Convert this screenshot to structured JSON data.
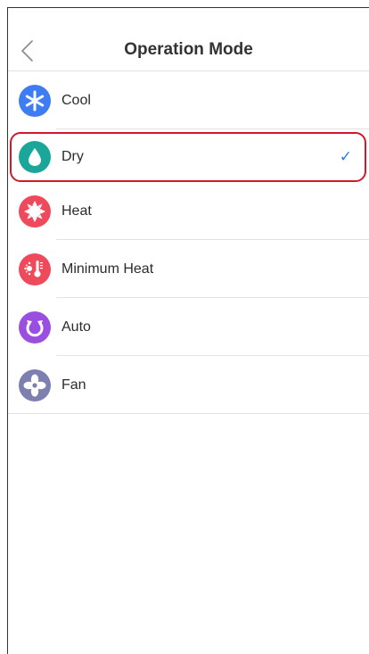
{
  "header": {
    "title": "Operation Mode"
  },
  "modes": [
    {
      "label": "Cool",
      "icon": "snowflake-icon",
      "color": "#3d7cf2"
    },
    {
      "label": "Dry",
      "icon": "water-drop-icon",
      "color": "#1aa79a",
      "selected": true
    },
    {
      "label": "Heat",
      "icon": "sun-icon",
      "color": "#ef4a5c"
    },
    {
      "label": "Minimum Heat",
      "icon": "thermometer-icon",
      "color": "#ef4a5c"
    },
    {
      "label": "Auto",
      "icon": "auto-cycle-icon",
      "color": "#9b4fe0"
    },
    {
      "label": "Fan",
      "icon": "fan-icon",
      "color": "#7c7fb0"
    }
  ],
  "selection": {
    "check_glyph": "✓",
    "check_color": "#2a7de1",
    "highlight_color": "#d0192b"
  }
}
